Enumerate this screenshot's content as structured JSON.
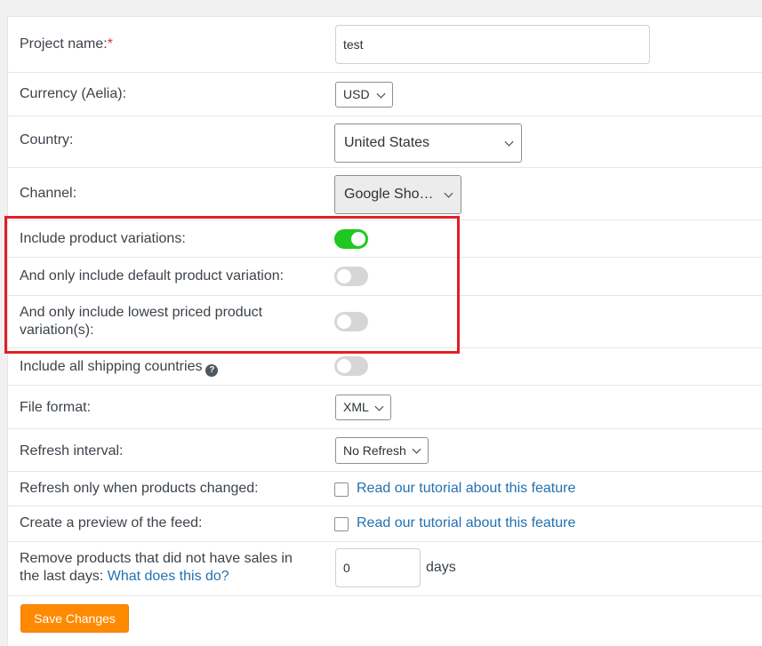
{
  "form": {
    "project_name": {
      "label": "Project name:",
      "required_mark": "*",
      "value": "test"
    },
    "currency": {
      "label": "Currency (Aelia):",
      "value": "USD"
    },
    "country": {
      "label": "Country:",
      "value": "United States"
    },
    "channel": {
      "label": "Channel:",
      "value": "Google Sho…"
    },
    "include_variations": {
      "label": "Include product variations:",
      "enabled": true
    },
    "default_variation": {
      "label": "And only include default product variation:",
      "enabled": false
    },
    "lowest_priced": {
      "label_line1": "And only include lowest priced product",
      "label_line2": "variation(s):",
      "enabled": false
    },
    "shipping_countries": {
      "label": "Include all shipping countries",
      "help_icon": "?",
      "enabled": false
    },
    "file_format": {
      "label": "File format:",
      "value": "XML"
    },
    "refresh_interval": {
      "label": "Refresh interval:",
      "value": "No Refresh"
    },
    "refresh_changed": {
      "label": "Refresh only when products changed:",
      "checked": false,
      "link": "Read our tutorial about this feature"
    },
    "preview": {
      "label": "Create a preview of the feed:",
      "checked": false,
      "link": "Read our tutorial about this feature"
    },
    "remove_products": {
      "label_line1": "Remove products that did not have sales in",
      "label_line2": "the last days:",
      "link": "What does this do?",
      "value": "0",
      "unit": "days"
    },
    "save_button": "Save Changes"
  },
  "colors": {
    "accent_orange": "#ff8a00",
    "toggle_on": "#1fc81f",
    "toggle_off": "#d6d6d6",
    "link": "#2271b1",
    "highlight_border": "#e31e24"
  }
}
